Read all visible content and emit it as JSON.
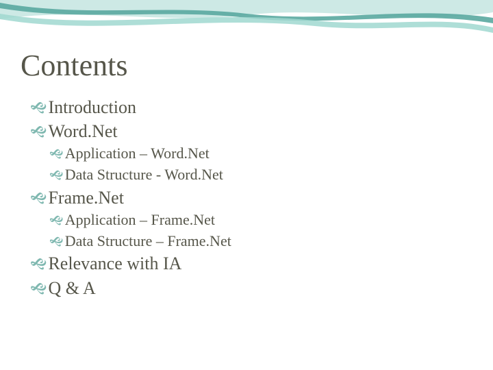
{
  "colors": {
    "text": "#56564a",
    "bullet": "#7fb8b0",
    "wave1": "#a0d8d0",
    "wave2": "#5aa8a0"
  },
  "title": "Contents",
  "items": [
    {
      "level": 1,
      "text": "Introduction"
    },
    {
      "level": 1,
      "text": "Word.Net"
    },
    {
      "level": 2,
      "text": "Application – Word.Net"
    },
    {
      "level": 2,
      "text": "Data Structure - Word.Net"
    },
    {
      "level": 1,
      "text": "Frame.Net"
    },
    {
      "level": 2,
      "text": "Application – Frame.Net"
    },
    {
      "level": 2,
      "text": "Data Structure – Frame.Net"
    },
    {
      "level": 1,
      "text": "Relevance with IA"
    },
    {
      "level": 1,
      "text": "Q & A"
    }
  ]
}
